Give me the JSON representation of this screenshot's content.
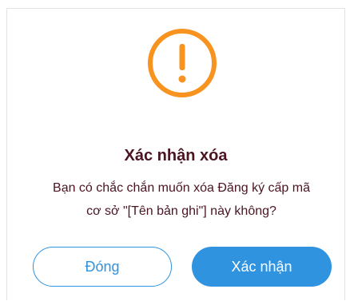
{
  "dialog": {
    "icon": "warning-exclamation-icon",
    "icon_color": "#f7931e",
    "title": "Xác nhận xóa",
    "message_line1": "Bạn có chắc chắn muốn xóa Đăng ký cấp mã",
    "message_line2": "cơ sở \"[Tên bản ghi\"] này không?",
    "close_label": "Đóng",
    "confirm_label": "Xác nhận",
    "accent_color": "#2f93e0",
    "text_color": "#4a1421"
  }
}
